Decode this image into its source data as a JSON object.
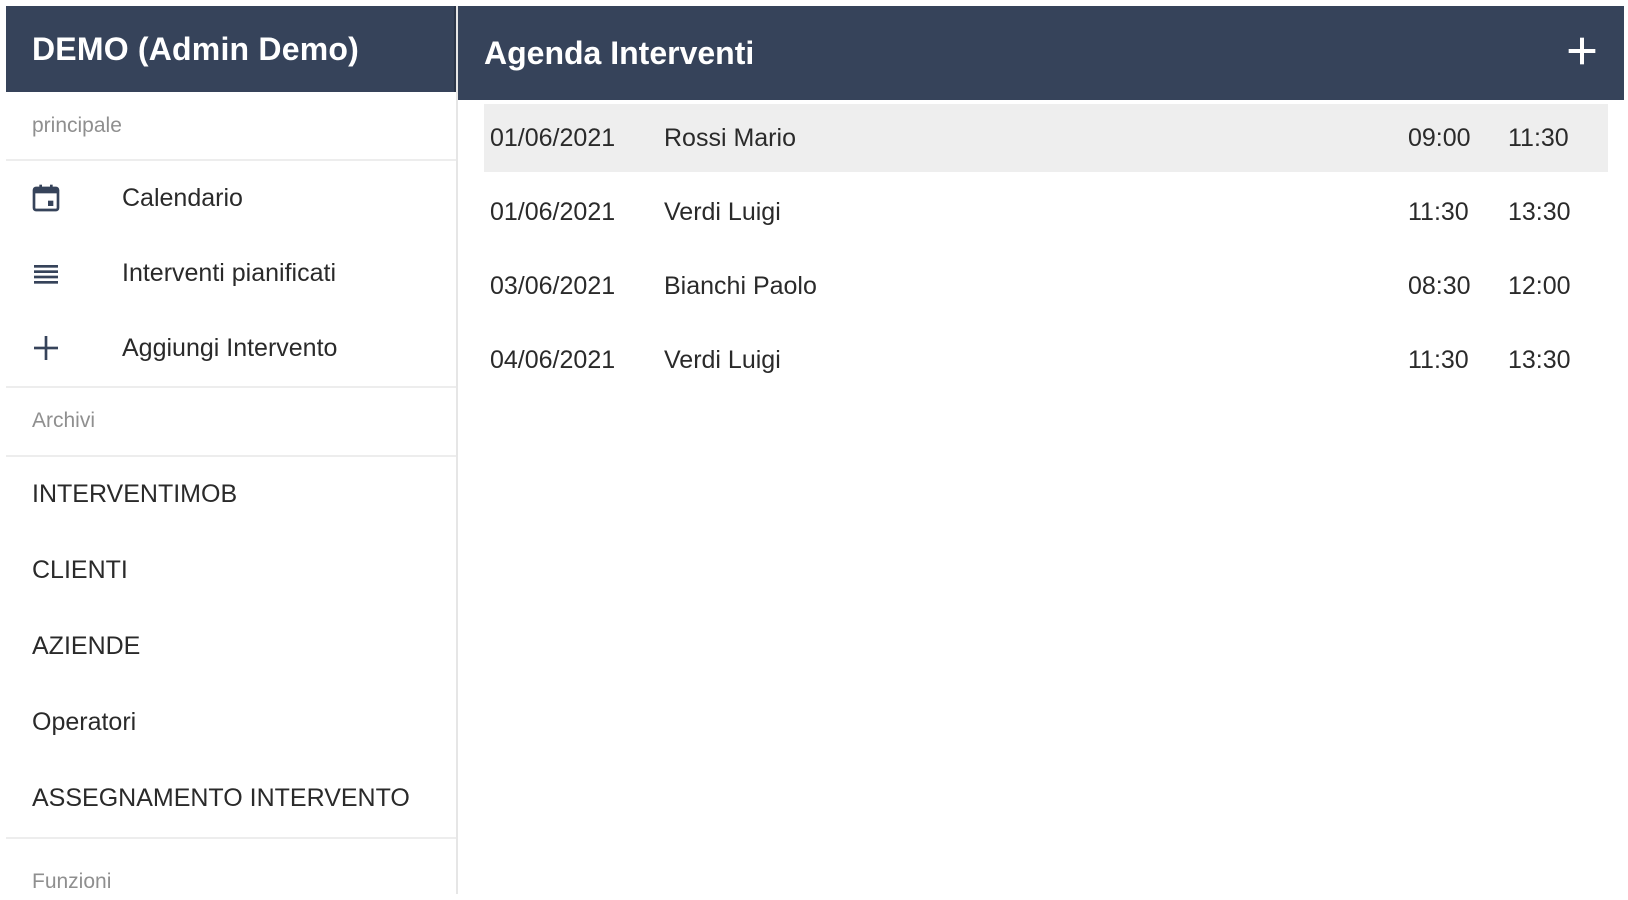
{
  "sidebar": {
    "title": "DEMO (Admin Demo)",
    "section_main": "principale",
    "main_items": [
      {
        "label": "Calendario",
        "icon": "calendar-icon"
      },
      {
        "label": "Interventi pianificati",
        "icon": "list-icon"
      },
      {
        "label": "Aggiungi Intervento",
        "icon": "plus-icon"
      }
    ],
    "section_archives": "Archivi",
    "archive_items": [
      {
        "label": "INTERVENTIMOB"
      },
      {
        "label": "CLIENTI"
      },
      {
        "label": "AZIENDE"
      },
      {
        "label": "Operatori"
      },
      {
        "label": "ASSEGNAMENTO INTERVENTO"
      }
    ],
    "section_functions": "Funzioni"
  },
  "main": {
    "title": "Agenda Interventi",
    "add_icon": "plus-icon",
    "rows": [
      {
        "date": "01/06/2021",
        "name": "Rossi Mario",
        "start": "09:00",
        "end": "11:30",
        "selected": true
      },
      {
        "date": "01/06/2021",
        "name": "Verdi Luigi",
        "start": "11:30",
        "end": "13:30",
        "selected": false
      },
      {
        "date": "03/06/2021",
        "name": "Bianchi Paolo",
        "start": "08:30",
        "end": "12:00",
        "selected": false
      },
      {
        "date": "04/06/2021",
        "name": "Verdi Luigi",
        "start": "11:30",
        "end": "13:30",
        "selected": false
      }
    ]
  },
  "colors": {
    "header_bg": "#36435a",
    "selected_row": "#eeeeee",
    "icon": "#36435a"
  }
}
